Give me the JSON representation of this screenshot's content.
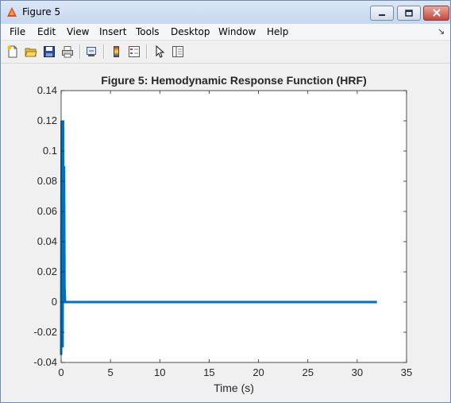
{
  "window": {
    "title": "Figure 5",
    "icons": {
      "app": "matlab-figure-icon",
      "minimize": "minimize-icon",
      "maximize": "maximize-icon",
      "close": "close-icon"
    }
  },
  "menubar": {
    "items": [
      "File",
      "Edit",
      "View",
      "Insert",
      "Tools",
      "Desktop",
      "Window",
      "Help"
    ],
    "overflow_icon": "menu-overflow-arrow-icon"
  },
  "toolbar": {
    "buttons": [
      "new-figure-icon",
      "open-file-icon",
      "save-icon",
      "print-icon",
      "link-plot-icon",
      "insert-colorbar-icon",
      "insert-legend-icon",
      "edit-plot-pointer-icon",
      "property-inspector-icon"
    ]
  },
  "colors": {
    "line": "#0072bd",
    "axes": "#262626",
    "background": "#f0f0f0",
    "plot_bg": "#ffffff"
  },
  "chart_data": {
    "type": "line",
    "title": "Figure 5: Hemodynamic Response Function (HRF)",
    "xlabel": "Time (s)",
    "ylabel": "",
    "xlim": [
      0,
      35
    ],
    "ylim": [
      -0.04,
      0.14
    ],
    "xticks": [
      0,
      5,
      10,
      15,
      20,
      25,
      30,
      35
    ],
    "yticks": [
      -0.04,
      -0.02,
      0,
      0.02,
      0.04,
      0.06,
      0.08,
      0.1,
      0.12,
      0.14
    ],
    "xtick_labels": [
      "0",
      "5",
      "10",
      "15",
      "20",
      "25",
      "30",
      "35"
    ],
    "ytick_labels": [
      "-0.04",
      "-0.02",
      "0",
      "0.02",
      "0.04",
      "0.06",
      "0.08",
      "0.1",
      "0.12",
      "0.14"
    ],
    "grid": false,
    "series": [
      {
        "x": [
          0,
          0.05,
          0.1,
          0.15,
          0.2,
          0.25,
          0.3,
          0.35,
          0.4,
          0.5,
          1,
          2,
          5,
          10,
          15,
          20,
          25,
          30,
          32
        ],
        "values": [
          -0.035,
          0.12,
          0.1,
          -0.03,
          0.12,
          0.0,
          0.09,
          0.01,
          0.0,
          0.0,
          0.0,
          0.0,
          0.0,
          0.0,
          0.0,
          0.0,
          0.0,
          0.0,
          0.0
        ]
      }
    ]
  }
}
